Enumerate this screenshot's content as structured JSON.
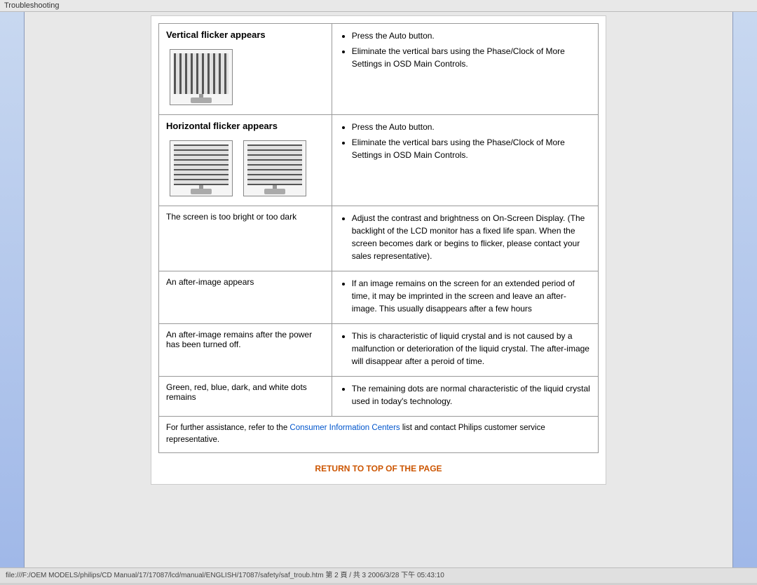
{
  "topbar": {
    "label": "Troubleshooting"
  },
  "footer_bar": {
    "text": "file:///F:/OEM MODELS/philips/CD Manual/17/17087/lcd/manual/ENGLISH/17087/safety/saf_troub.htm 第 2 頁 / 共 3 2006/3/28 下午 05:43:10"
  },
  "table": {
    "rows": [
      {
        "id": "vertical-flicker",
        "problem": "Vertical flicker appears",
        "has_image": true,
        "image_type": "vertical",
        "image_count": 1,
        "solutions": [
          "Press the Auto button.",
          "Eliminate the vertical bars using the Phase/Clock of More Settings in OSD Main Controls."
        ]
      },
      {
        "id": "horizontal-flicker",
        "problem": "Horizontal flicker appears",
        "has_image": true,
        "image_type": "horizontal",
        "image_count": 2,
        "solutions": [
          "Press the Auto button.",
          "Eliminate the vertical bars using the Phase/Clock of More Settings in OSD Main Controls."
        ]
      },
      {
        "id": "brightness",
        "problem": "The screen is too bright or too dark",
        "has_image": false,
        "solutions": [
          "Adjust the contrast and brightness on On-Screen Display. (The backlight of the LCD monitor has a fixed life span. When the screen becomes dark or begins to flicker, please contact your sales representative)."
        ]
      },
      {
        "id": "after-image",
        "problem": "An after-image appears",
        "has_image": false,
        "solutions": [
          "If an image remains on the screen for an extended period of time, it may be imprinted in the screen and leave an after-image. This usually disappears after a few hours"
        ]
      },
      {
        "id": "after-image-power",
        "problem": "An after-image remains after the power has been turned off.",
        "has_image": false,
        "solutions": [
          "This is characteristic of liquid crystal and is not caused by a malfunction or deterioration of the liquid crystal. The after-image will disappear after a peroid of time."
        ]
      },
      {
        "id": "dots",
        "problem": "Green, red, blue, dark, and white dots remains",
        "has_image": false,
        "solutions": [
          "The remaining dots are normal characteristic of the liquid crystal used in today's technology."
        ]
      }
    ],
    "footer_text_pre": "For further assistance, refer to the ",
    "footer_link_text": "Consumer Information Centers",
    "footer_text_post": " list and contact Philips customer service representative.",
    "return_label": "RETURN TO TOP OF THE PAGE"
  }
}
